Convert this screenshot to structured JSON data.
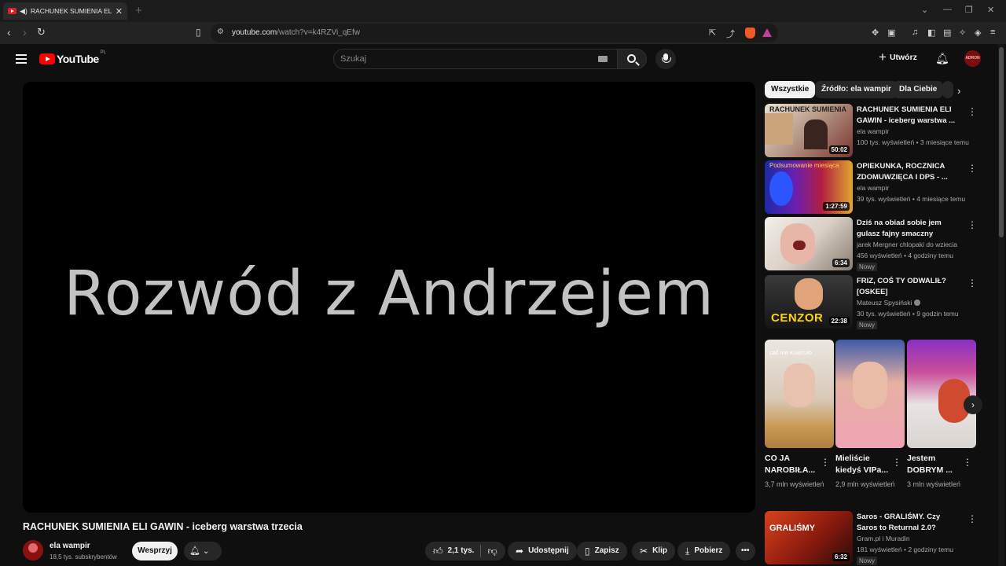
{
  "browser": {
    "tab_title": "RACHUNEK SUMIENIA ELI GAWIN - iceberg warstwa trzecia",
    "url_host": "youtube.com",
    "url_path": "/watch?v=k4RZVi_qEfw"
  },
  "header": {
    "logo_text": "YouTube",
    "country_code": "PL",
    "search_placeholder": "Szukaj",
    "create_label": "Utwórz",
    "avatar_text": "ADRON"
  },
  "video": {
    "overlay_text": "Rozwód z Andrzejem",
    "title": "RACHUNEK SUMIENIA ELI GAWIN - iceberg warstwa trzecia",
    "channel": "ela wampir",
    "subscribers": "18,5 tys. subskrybentów",
    "support_label": "Wesprzyj",
    "likes": "2,1 tys.",
    "share_label": "Udostępnij",
    "save_label": "Zapisz",
    "clip_label": "Klip",
    "download_label": "Pobierz"
  },
  "chips": [
    "Wszystkie",
    "Źródło: ela wampir",
    "Dla Ciebie"
  ],
  "recommendations": [
    {
      "title": "RACHUNEK SUMIENIA ELI GAWIN - iceberg warstwa ...",
      "channel": "ela wampir",
      "meta": "100 tys. wyświetleń • 3 miesiące temu",
      "duration": "50:02",
      "badge": ""
    },
    {
      "title": "OPIEKUNKA, ROCZNICA ZDOMUWZIĘCA I DPS - ...",
      "channel": "ela wampir",
      "meta": "39 tys. wyświetleń • 4 miesiące temu",
      "duration": "1:27:59",
      "badge": ""
    },
    {
      "title": "Dziś na obiad sobie jem gulasz fajny smaczny",
      "channel": "jarek Mergner chlopaki do wziecia",
      "meta": "456 wyświetleń • 4 godziny temu",
      "duration": "6:34",
      "badge": "Nowy"
    },
    {
      "title": "FRIZ, COŚ TY ODWALIŁ? [OSKEE]",
      "channel": "Mateusz Spysiński",
      "meta": "30 tys. wyświetleń • 9 godzin temu",
      "duration": "22:38",
      "badge": "Nowy"
    },
    {
      "title": "Saros - GRALIŚMY. Czy Saros to Returnal 2.0?",
      "channel": "Gram.pl i Muradin",
      "meta": "181 wyświetleń • 2 godziny temu",
      "duration": "6:32",
      "badge": "Nowy"
    }
  ],
  "thumb_text": {
    "t1_top": "RACHUNEK SUMIENIA",
    "t2_top": "Podsumowanie miesiąca",
    "t4_bottom": "CENZOR",
    "t5_top": "GRALIŚMY",
    "s1_caption": "call me Księżulo"
  },
  "shorts": [
    {
      "title": "CO JA NAROBIŁA...",
      "views": "3,7 mln wyświetleń"
    },
    {
      "title": "Mieliście kiedyś VIPa...",
      "views": "2,9 mln wyświetleń"
    },
    {
      "title": "Jestem DOBRYM ...",
      "views": "3 mln wyświetleń"
    }
  ]
}
